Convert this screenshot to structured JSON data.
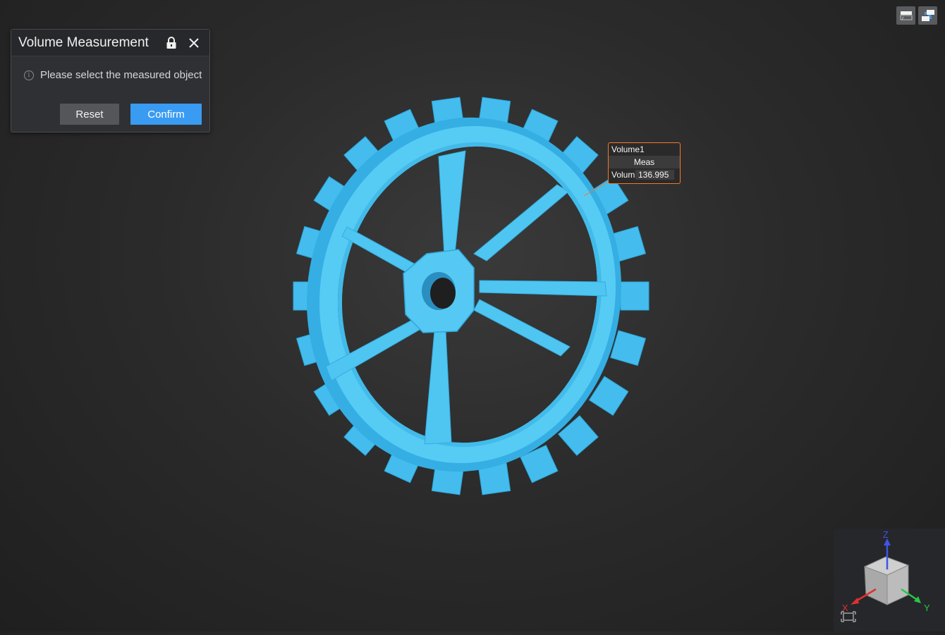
{
  "panel": {
    "title": "Volume Measurement",
    "hint": "Please select the measured object",
    "reset_label": "Reset",
    "confirm_label": "Confirm"
  },
  "label": {
    "name": "Volume1",
    "header": "Meas",
    "key": "Volum",
    "value": "136.995"
  },
  "navcube": {
    "axis_z": "Z",
    "axis_x": "X",
    "axis_y": "Y"
  },
  "colors": {
    "model": "#4cc6f2",
    "accent": "#3a9bf2",
    "label_border": "#f07a2a"
  }
}
